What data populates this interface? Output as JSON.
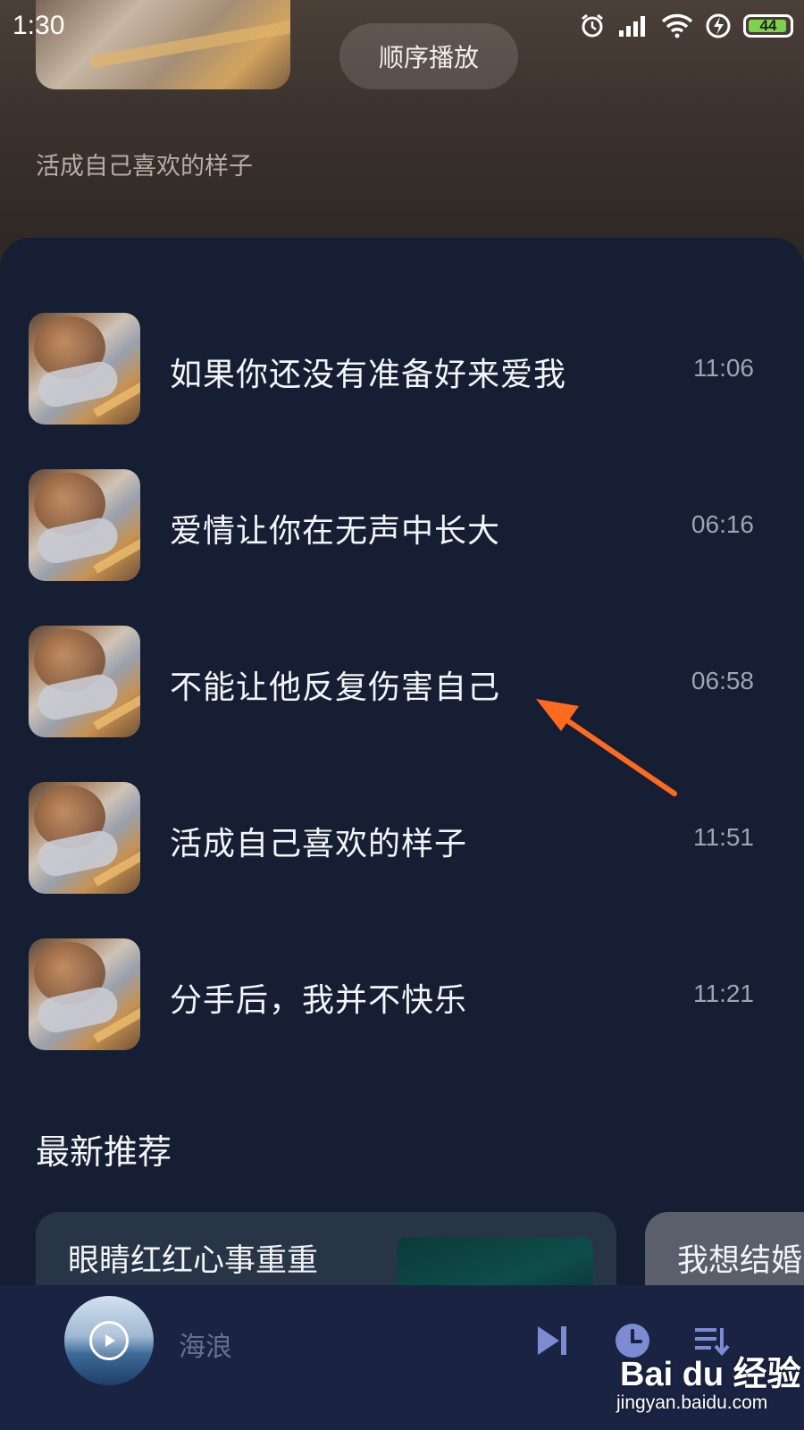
{
  "status_bar": {
    "time": "1:30",
    "battery_level": "44",
    "icons": [
      "alarm-icon",
      "signal-icon",
      "wifi-icon",
      "charging-icon",
      "battery-icon"
    ]
  },
  "header": {
    "play_order_label": "顺序播放",
    "subtitle": "活成自己喜欢的样子"
  },
  "songs": [
    {
      "title": "如果你还没有准备好来爱我",
      "duration": "11:06"
    },
    {
      "title": "爱情让你在无声中长大",
      "duration": "06:16"
    },
    {
      "title": "不能让他反复伤害自己",
      "duration": "06:58"
    },
    {
      "title": "活成自己喜欢的样子",
      "duration": "11:51"
    },
    {
      "title": "分手后，我并不快乐",
      "duration": "11:21"
    }
  ],
  "recommend": {
    "section_title": "最新推荐",
    "cards": [
      {
        "title": "眼睛红红心事重重"
      },
      {
        "title": "我想结婚"
      }
    ]
  },
  "player": {
    "title": "海浪",
    "controls": [
      "next-icon",
      "timer-icon",
      "playlist-icon"
    ]
  },
  "watermark": {
    "logo": "Bai du 经验",
    "url": "jingyan.baidu.com"
  },
  "colors": {
    "panel_bg": "#161e33",
    "player_bg": "#1a2342",
    "annotation_arrow": "#ff6a1f"
  }
}
